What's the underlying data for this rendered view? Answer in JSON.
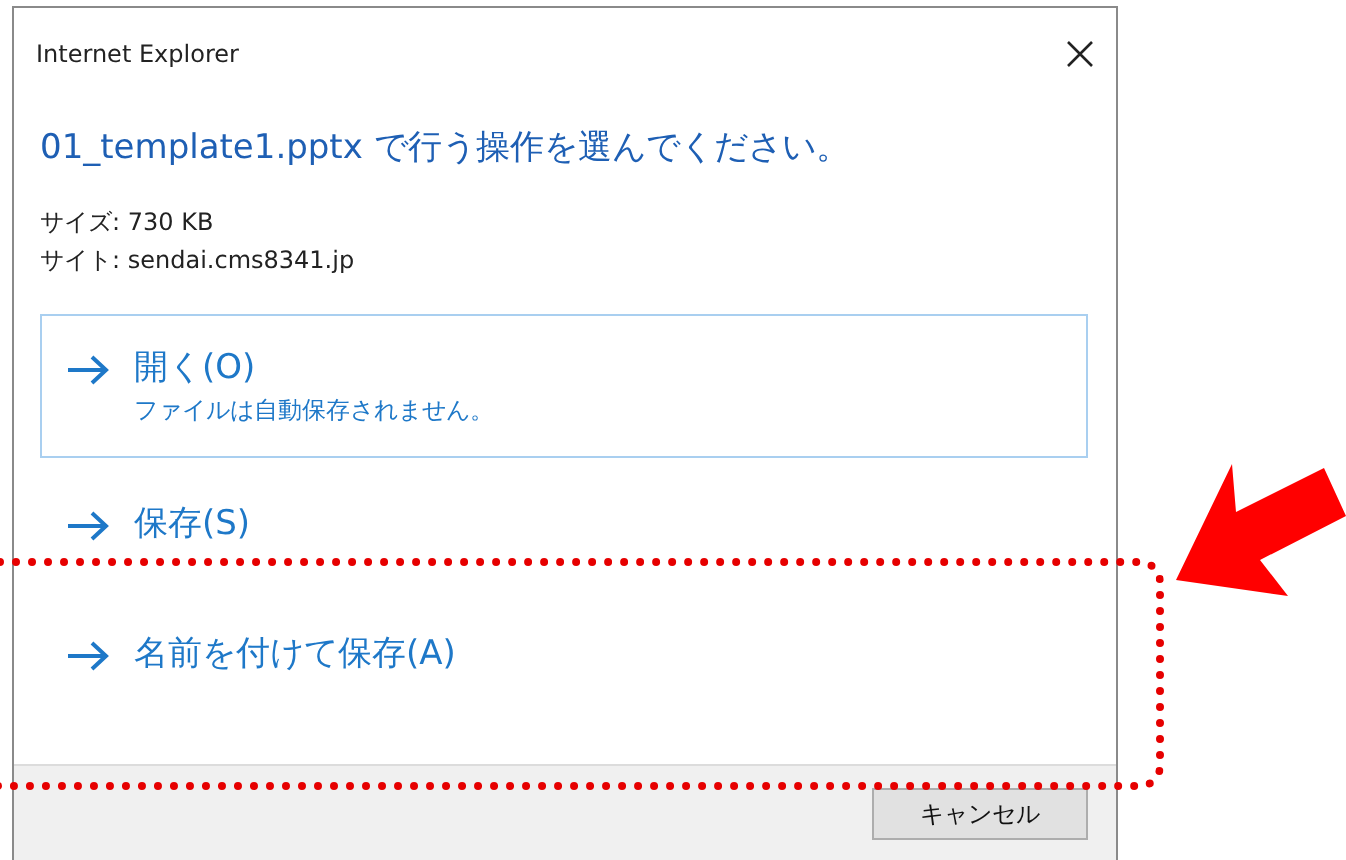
{
  "window": {
    "title": "Internet Explorer"
  },
  "heading": "01_template1.pptx で行う操作を選んでください。",
  "details": [
    "サイズ: 730 KB",
    "サイト: sendai.cms8341.jp"
  ],
  "options": [
    {
      "label": "開く(O)",
      "note": "ファイルは自動保存されません。",
      "selected": true
    },
    {
      "label": "保存(S)",
      "selected": false
    },
    {
      "label": "名前を付けて保存(A)",
      "selected": false
    }
  ],
  "buttons": [
    "キャンセル"
  ]
}
